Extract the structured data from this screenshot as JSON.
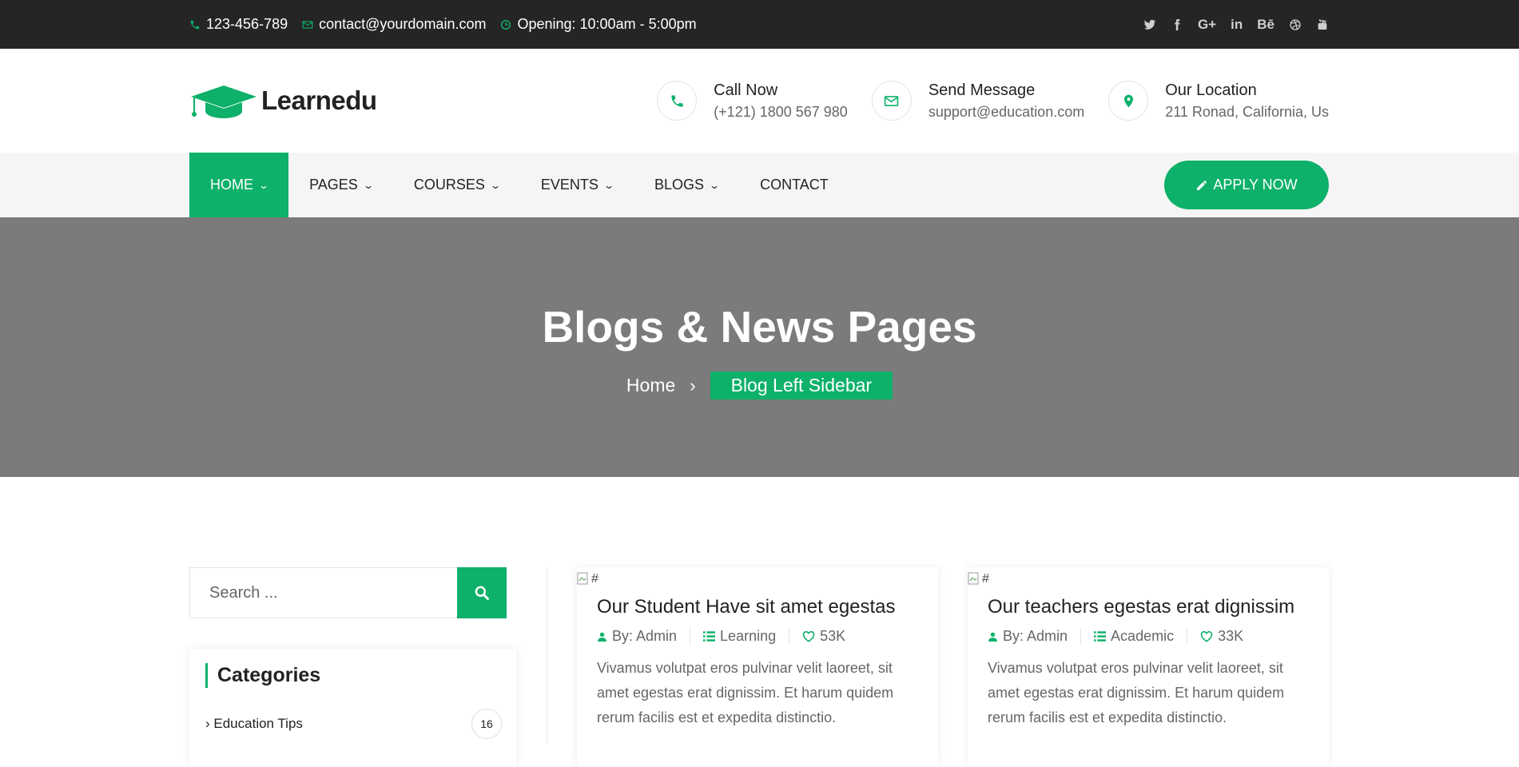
{
  "topbar": {
    "phone": "123-456-789",
    "email": "contact@yourdomain.com",
    "hours": "Opening: 10:00am - 5:00pm",
    "social": [
      "twitter-icon",
      "facebook-icon",
      "google-plus-icon",
      "linkedin-icon",
      "behance-icon",
      "dribbble-icon",
      "youtube-icon"
    ]
  },
  "header": {
    "logo_text": "Learnedu",
    "contacts": [
      {
        "title": "Call Now",
        "sub": "(+121) 1800 567 980",
        "icon": "phone-icon"
      },
      {
        "title": "Send Message",
        "sub": "support@education.com",
        "icon": "envelope-icon"
      },
      {
        "title": "Our Location",
        "sub": "211 Ronad, California, Us",
        "icon": "map-pin-icon"
      }
    ]
  },
  "nav": {
    "items": [
      {
        "label": "HOME",
        "dropdown": true,
        "active": true
      },
      {
        "label": "PAGES",
        "dropdown": true
      },
      {
        "label": "COURSES",
        "dropdown": true
      },
      {
        "label": "EVENTS",
        "dropdown": true
      },
      {
        "label": "BLOGS",
        "dropdown": true
      },
      {
        "label": "CONTACT",
        "dropdown": false
      }
    ],
    "apply_label": "APPLY NOW"
  },
  "hero": {
    "title": "Blogs & News Pages",
    "breadcrumb_home": "Home",
    "breadcrumb_current": "Blog Left Sidebar"
  },
  "sidebar": {
    "search_placeholder": "Search ...",
    "categories_title": "Categories",
    "categories": [
      {
        "label": "Education Tips",
        "count": "16"
      }
    ]
  },
  "posts": [
    {
      "img_alt": "#",
      "title": "Our Student Have sit amet egestas",
      "author": "By: Admin",
      "category": "Learning",
      "likes": "53K",
      "excerpt": "Vivamus volutpat eros pulvinar velit laoreet, sit amet egestas erat dignissim. Et harum quidem rerum facilis est et expedita distinctio."
    },
    {
      "img_alt": "#",
      "title": "Our teachers egestas erat dignissim",
      "author": "By: Admin",
      "category": "Academic",
      "likes": "33K",
      "excerpt": "Vivamus volutpat eros pulvinar velit laoreet, sit amet egestas erat dignissim. Et harum quidem rerum facilis est et expedita distinctio."
    }
  ],
  "colors": {
    "accent": "#0db169",
    "topbar": "#252525",
    "hero": "#7b7b7b",
    "nav": "#f5f5f5"
  }
}
